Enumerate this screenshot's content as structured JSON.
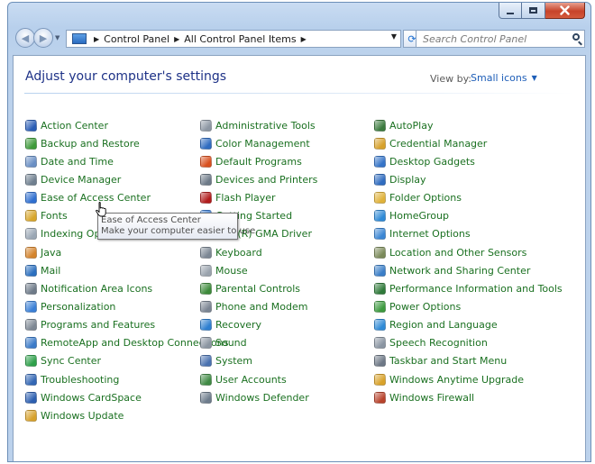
{
  "breadcrumb": [
    "Control Panel",
    "All Control Panel Items"
  ],
  "search": {
    "placeholder": "Search Control Panel"
  },
  "header": {
    "title": "Adjust your computer's settings",
    "view_by_label": "View by:",
    "view_mode": "Small icons"
  },
  "tooltip": {
    "title": "Ease of Access Center",
    "description": "Make your computer easier to use."
  },
  "colors": {
    "link": "#1a7020",
    "title": "#1e3287",
    "view_mode": "#1e5eb8"
  },
  "columns": [
    [
      {
        "label": "Action Center",
        "icon": "flag-icon",
        "color": "#2a5db5"
      },
      {
        "label": "Backup and Restore",
        "icon": "backup-icon",
        "color": "#3e9a3a"
      },
      {
        "label": "Date and Time",
        "icon": "calendar-clock-icon",
        "color": "#6a8fc4"
      },
      {
        "label": "Device Manager",
        "icon": "device-manager-icon",
        "color": "#6f7f8f"
      },
      {
        "label": "Ease of Access Center",
        "icon": "ease-of-access-icon",
        "color": "#2f6fd0"
      },
      {
        "label": "Fonts",
        "icon": "fonts-icon",
        "color": "#d8a62b"
      },
      {
        "label": "Indexing Options",
        "icon": "indexing-icon",
        "color": "#9aa6b4"
      },
      {
        "label": "Java",
        "icon": "java-icon",
        "color": "#d4832c"
      },
      {
        "label": "Mail",
        "icon": "mail-icon",
        "color": "#2b6fbf"
      },
      {
        "label": "Notification Area Icons",
        "icon": "notification-icon",
        "color": "#6e7a88"
      },
      {
        "label": "Personalization",
        "icon": "personalization-icon",
        "color": "#3a7fd6"
      },
      {
        "label": "Programs and Features",
        "icon": "programs-icon",
        "color": "#7d8793"
      },
      {
        "label": "RemoteApp and Desktop Connections",
        "icon": "remoteapp-icon",
        "color": "#3b7ac8"
      },
      {
        "label": "Sync Center",
        "icon": "sync-icon",
        "color": "#2ea04a"
      },
      {
        "label": "Troubleshooting",
        "icon": "troubleshooting-icon",
        "color": "#3266b4"
      },
      {
        "label": "Windows CardSpace",
        "icon": "cardspace-icon",
        "color": "#2c5fb0"
      },
      {
        "label": "Windows Update",
        "icon": "windows-update-icon",
        "color": "#d7a12b"
      }
    ],
    [
      {
        "label": "Administrative Tools",
        "icon": "admin-tools-icon",
        "color": "#8d97a3"
      },
      {
        "label": "Color Management",
        "icon": "color-management-icon",
        "color": "#2f6cc0"
      },
      {
        "label": "Default Programs",
        "icon": "default-programs-icon",
        "color": "#d8501f"
      },
      {
        "label": "Devices and Printers",
        "icon": "printer-icon",
        "color": "#6d7a88"
      },
      {
        "label": "Flash Player",
        "icon": "flash-icon",
        "color": "#b11c1c"
      },
      {
        "label": "Getting Started",
        "icon": "getting-started-icon",
        "color": "#3b7cd0"
      },
      {
        "label": "Intel(R) GMA Driver",
        "icon": "intel-icon",
        "color": "#2b68b3"
      },
      {
        "label": "Keyboard",
        "icon": "keyboard-icon",
        "color": "#7c8794"
      },
      {
        "label": "Mouse",
        "icon": "mouse-icon",
        "color": "#9aa3ad"
      },
      {
        "label": "Parental Controls",
        "icon": "parental-controls-icon",
        "color": "#3d8a3a"
      },
      {
        "label": "Phone and Modem",
        "icon": "phone-modem-icon",
        "color": "#7b8593"
      },
      {
        "label": "Recovery",
        "icon": "recovery-icon",
        "color": "#2e7fd0"
      },
      {
        "label": "Sound",
        "icon": "sound-icon",
        "color": "#8b95a1"
      },
      {
        "label": "System",
        "icon": "system-icon",
        "color": "#4a72b0"
      },
      {
        "label": "User Accounts",
        "icon": "user-accounts-icon",
        "color": "#3f8a44"
      },
      {
        "label": "Windows Defender",
        "icon": "defender-icon",
        "color": "#6e7c8c"
      }
    ],
    [
      {
        "label": "AutoPlay",
        "icon": "autoplay-icon",
        "color": "#3b7a3e"
      },
      {
        "label": "Credential Manager",
        "icon": "credential-icon",
        "color": "#d7a12b"
      },
      {
        "label": "Desktop Gadgets",
        "icon": "gadgets-icon",
        "color": "#3574c8"
      },
      {
        "label": "Display",
        "icon": "display-icon",
        "color": "#2f6cc0"
      },
      {
        "label": "Folder Options",
        "icon": "folder-icon",
        "color": "#e0b23a"
      },
      {
        "label": "HomeGroup",
        "icon": "homegroup-icon",
        "color": "#2f8ad6"
      },
      {
        "label": "Internet Options",
        "icon": "internet-options-icon",
        "color": "#3b86d4"
      },
      {
        "label": "Location and Other Sensors",
        "icon": "location-icon",
        "color": "#7b8a5a"
      },
      {
        "label": "Network and Sharing Center",
        "icon": "network-icon",
        "color": "#3a7ec8"
      },
      {
        "label": "Performance Information and Tools",
        "icon": "performance-icon",
        "color": "#2f7a3a"
      },
      {
        "label": "Power Options",
        "icon": "power-icon",
        "color": "#3d9a3f"
      },
      {
        "label": "Region and Language",
        "icon": "region-icon",
        "color": "#2f8ad6"
      },
      {
        "label": "Speech Recognition",
        "icon": "microphone-icon",
        "color": "#8a95a2"
      },
      {
        "label": "Taskbar and Start Menu",
        "icon": "taskbar-icon",
        "color": "#6d7886"
      },
      {
        "label": "Windows Anytime Upgrade",
        "icon": "anytime-upgrade-icon",
        "color": "#d9a22a"
      },
      {
        "label": "Windows Firewall",
        "icon": "firewall-icon",
        "color": "#b8432c"
      }
    ]
  ]
}
